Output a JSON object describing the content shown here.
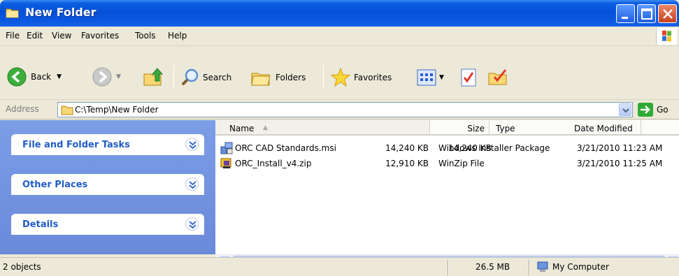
{
  "window": {
    "title": "New Folder"
  },
  "menu": [
    {
      "label": "File"
    },
    {
      "label": "Edit"
    },
    {
      "label": "View"
    },
    {
      "label": "Favorites"
    },
    {
      "label": "Tools"
    },
    {
      "label": "Help"
    }
  ],
  "toolbar": {
    "back_label": "Back",
    "search_label": "Search",
    "folders_label": "Folders",
    "favorites_label": "Favorites"
  },
  "address": {
    "label": "Address",
    "value": "C:\\Temp\\New Folder",
    "go_label": "Go"
  },
  "taskpane": {
    "sections": [
      {
        "title": "File and Folder Tasks"
      },
      {
        "title": "Other Places"
      },
      {
        "title": "Details"
      }
    ]
  },
  "filelist": {
    "columns": [
      "Name",
      "Size",
      "Type",
      "Date Modified"
    ],
    "rows": [
      {
        "name": "ORC CAD Standards.msi",
        "size": "14,240 KB",
        "type": "Windows Installer Package",
        "modified": "3/21/2010 11:23 AM",
        "icon": "msi-installer-icon"
      },
      {
        "name": "ORC_Install_v4.zip",
        "size": "12,910 KB",
        "type": "WinZip File",
        "modified": "3/21/2010 11:25 AM",
        "icon": "winzip-icon"
      }
    ]
  },
  "status": {
    "objects": "2 objects",
    "size": "26.5 MB",
    "location": "My Computer"
  },
  "colors": {
    "titlebar": "#0a57e0",
    "taskpane": "#7b9ee6",
    "task_title": "#215dc6"
  }
}
